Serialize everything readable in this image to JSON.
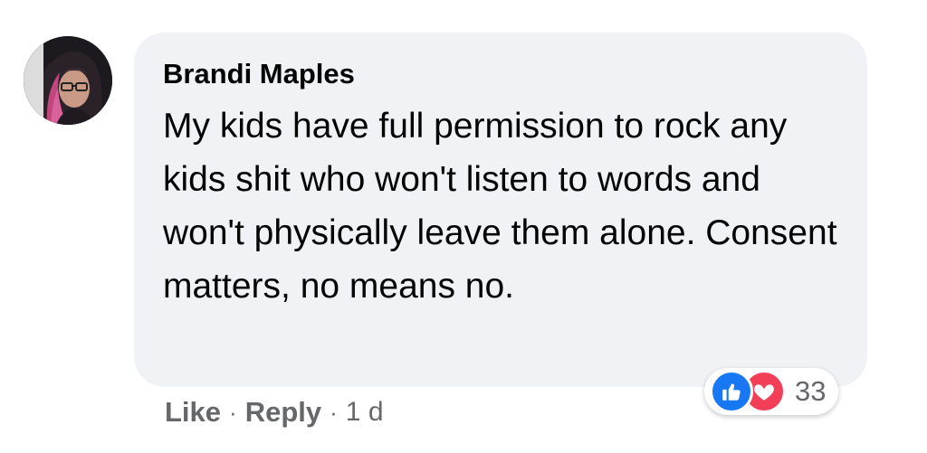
{
  "comment": {
    "author": "Brandi Maples",
    "text": "My kids have full permission to rock any kids shit who won't listen to words and won't physically leave them alone. Consent matters, no means no.",
    "timestamp": "1 d"
  },
  "actions": {
    "like_label": "Like",
    "reply_label": "Reply",
    "separator": "·"
  },
  "reactions": {
    "count": "33",
    "icons": [
      "like-icon",
      "love-icon"
    ],
    "like_color": "#1877f2",
    "love_color": "#f33e58"
  },
  "colors": {
    "bubble": "#f0f2f5",
    "text": "#050505",
    "secondary_text": "#65676b"
  }
}
